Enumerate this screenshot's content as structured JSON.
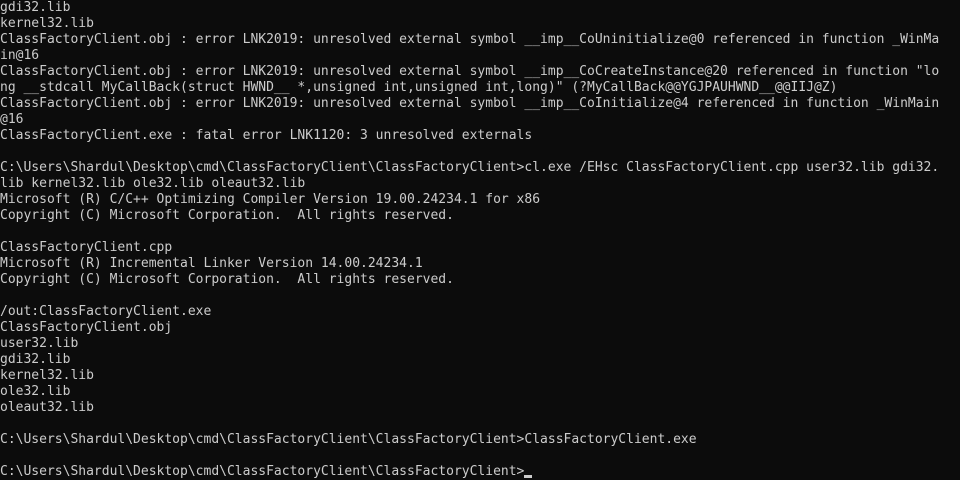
{
  "console": {
    "lines": [
      "gdi32.lib",
      "kernel32.lib",
      "ClassFactoryClient.obj : error LNK2019: unresolved external symbol __imp__CoUninitialize@0 referenced in function _WinMa",
      "in@16",
      "ClassFactoryClient.obj : error LNK2019: unresolved external symbol __imp__CoCreateInstance@20 referenced in function \"lo",
      "ng __stdcall MyCallBack(struct HWND__ *,unsigned int,unsigned int,long)\" (?MyCallBack@@YGJPAUHWND__@@IIJ@Z)",
      "ClassFactoryClient.obj : error LNK2019: unresolved external symbol __imp__CoInitialize@4 referenced in function _WinMain",
      "@16",
      "ClassFactoryClient.exe : fatal error LNK1120: 3 unresolved externals",
      "",
      "C:\\Users\\Shardul\\Desktop\\cmd\\ClassFactoryClient\\ClassFactoryClient>cl.exe /EHsc ClassFactoryClient.cpp user32.lib gdi32.",
      "lib kernel32.lib ole32.lib oleaut32.lib",
      "Microsoft (R) C/C++ Optimizing Compiler Version 19.00.24234.1 for x86",
      "Copyright (C) Microsoft Corporation.  All rights reserved.",
      "",
      "ClassFactoryClient.cpp",
      "Microsoft (R) Incremental Linker Version 14.00.24234.1",
      "Copyright (C) Microsoft Corporation.  All rights reserved.",
      "",
      "/out:ClassFactoryClient.exe",
      "ClassFactoryClient.obj",
      "user32.lib",
      "gdi32.lib",
      "kernel32.lib",
      "ole32.lib",
      "oleaut32.lib",
      "",
      "C:\\Users\\Shardul\\Desktop\\cmd\\ClassFactoryClient\\ClassFactoryClient>ClassFactoryClient.exe",
      ""
    ],
    "prompt": "C:\\Users\\Shardul\\Desktop\\cmd\\ClassFactoryClient\\ClassFactoryClient>",
    "colors": {
      "background": "#0c0c0c",
      "foreground": "#cccccc"
    }
  }
}
